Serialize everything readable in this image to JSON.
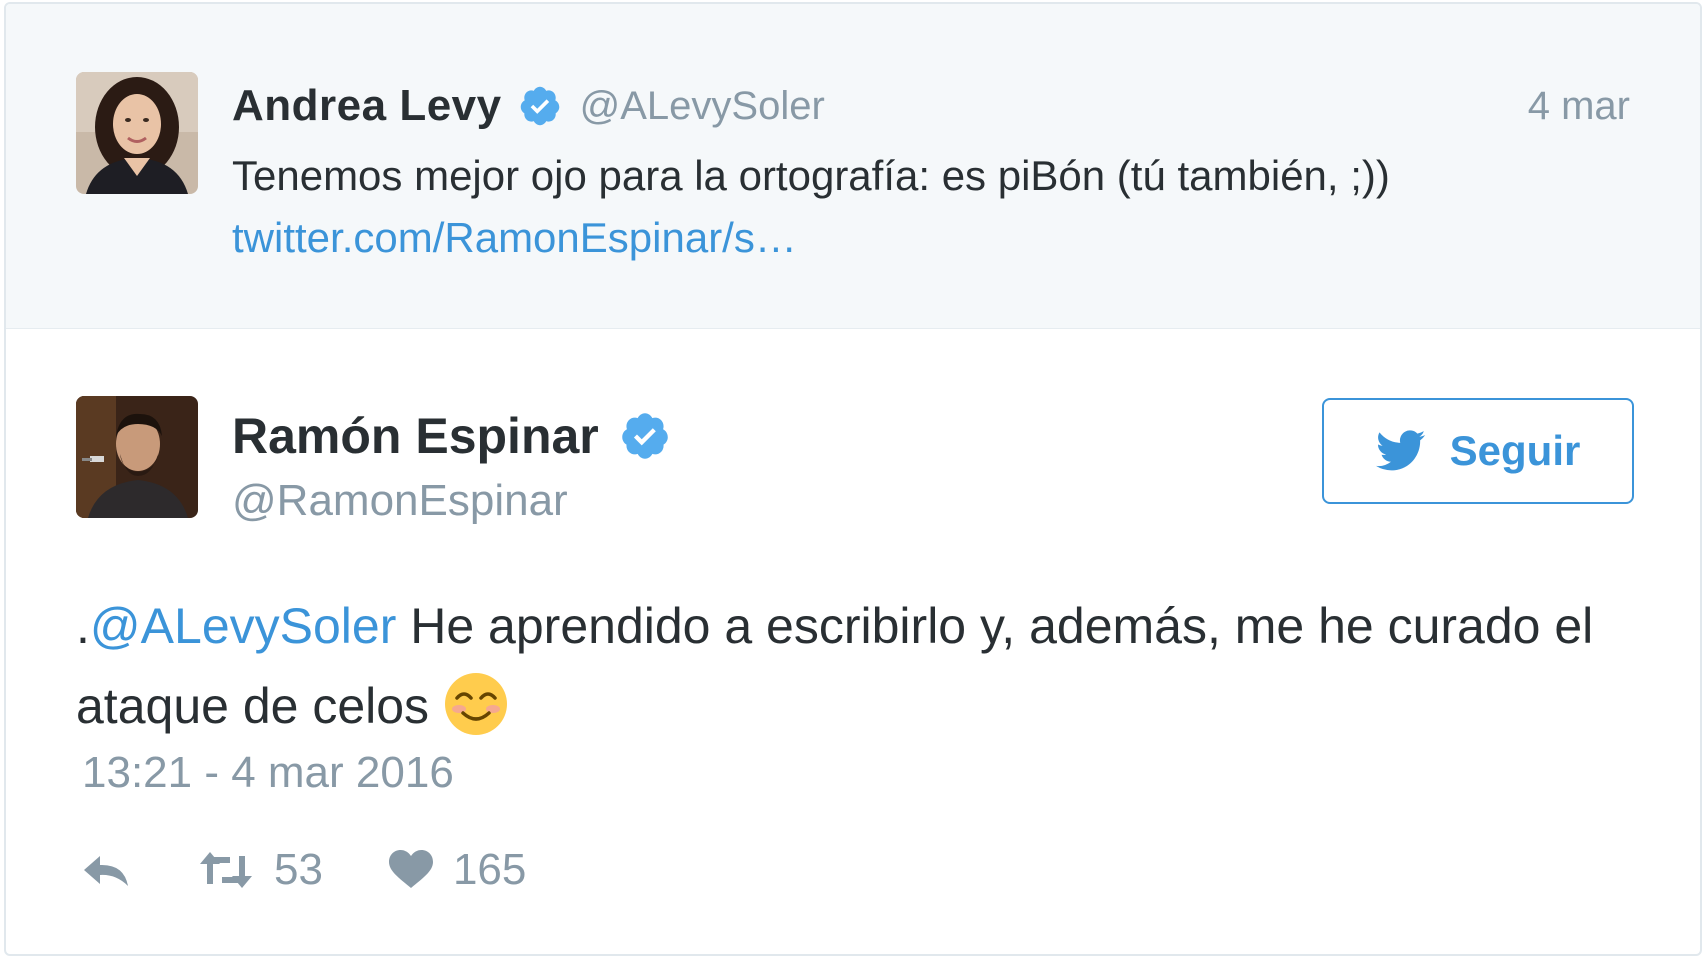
{
  "parent_tweet": {
    "author_name": "Andrea Levy",
    "verified_icon": "verified-badge-icon",
    "handle": "@ALevySoler",
    "date": "4 mar",
    "text": "Tenemos mejor ojo para la ortografía: es piBón (tú también, ;))",
    "link": "twitter.com/RamonEspinar/s…"
  },
  "main_tweet": {
    "author_name": "Ramón Espinar",
    "verified_icon": "verified-badge-icon",
    "handle": "@RamonEspinar",
    "follow_label": "Seguir",
    "text_prefix": ".",
    "mention": "@ALevySoler",
    "text_body": " He aprendido a escribirlo y, además, me he curado el ataque de celos",
    "emoji": "smiling-face-with-smiling-eyes",
    "timestamp": "13:21 - 4 mar 2016",
    "retweet_count": "53",
    "like_count": "165"
  },
  "colors": {
    "accent": "#3b94d9",
    "muted": "#8899a6",
    "text": "#292f33",
    "parent_bg": "#f5f8fa",
    "border": "#e1e8ed"
  }
}
